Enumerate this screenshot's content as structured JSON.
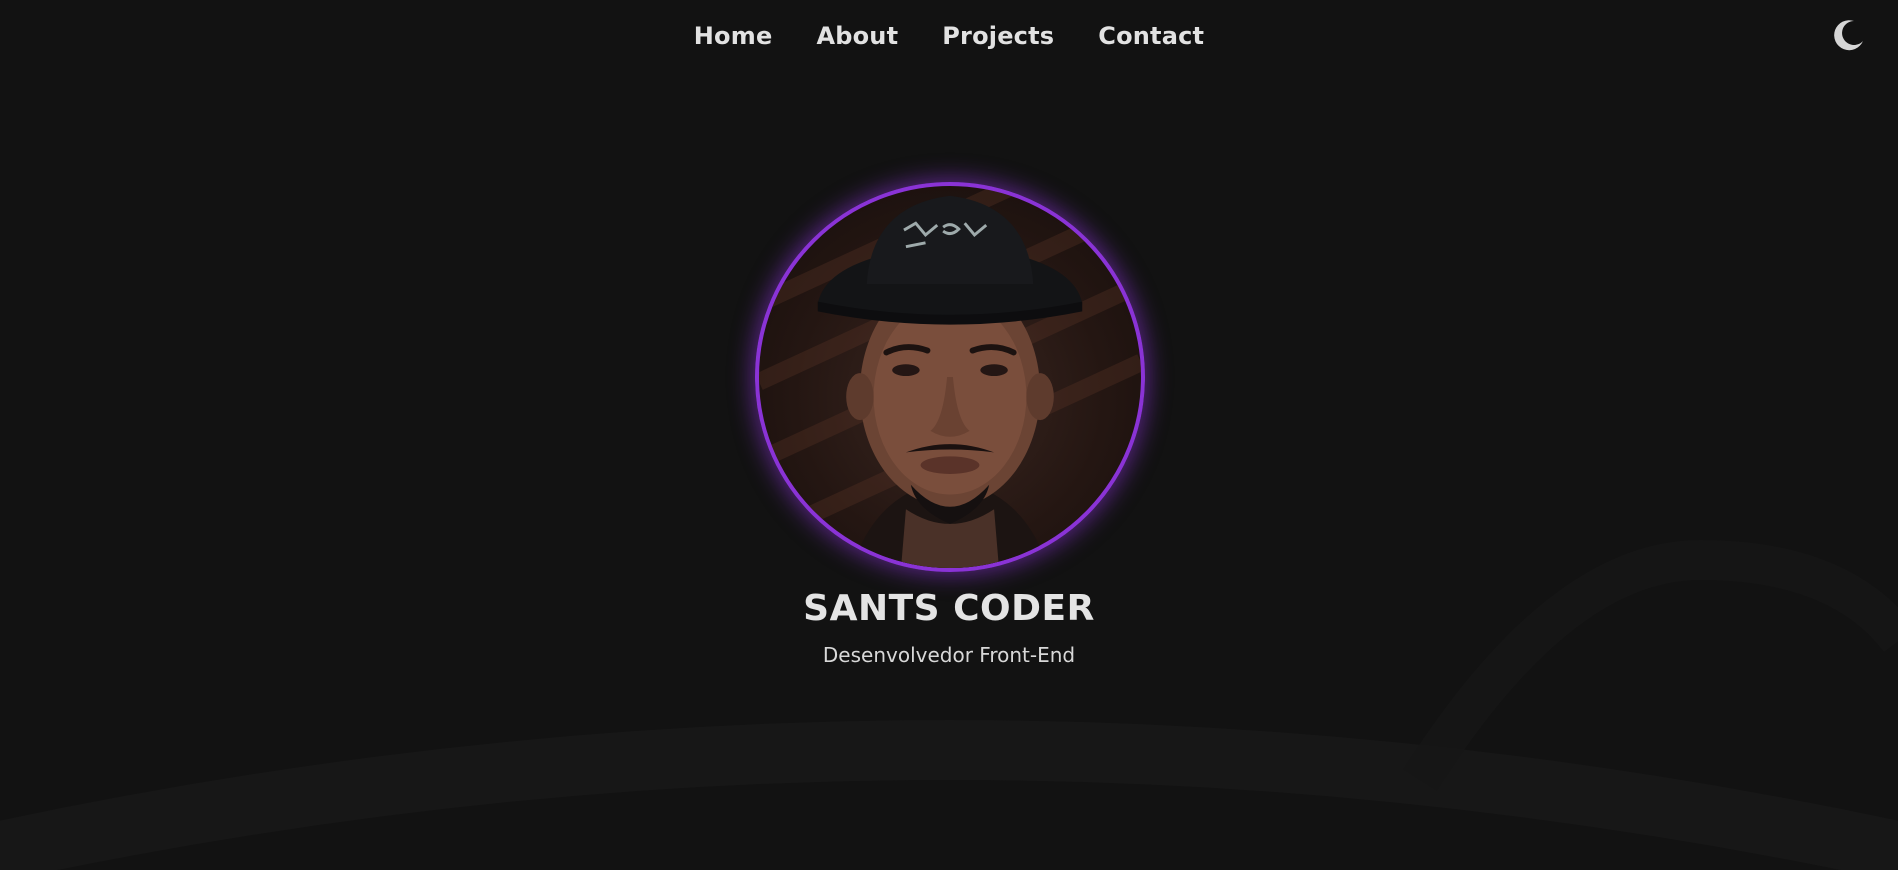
{
  "nav": {
    "items": [
      {
        "label": "Home"
      },
      {
        "label": "About"
      },
      {
        "label": "Projects"
      },
      {
        "label": "Contact"
      }
    ]
  },
  "theme_toggle": {
    "icon": "moon-icon"
  },
  "profile": {
    "name": "SANTS CODER",
    "role": "Desenvolvedor Front-End",
    "avatar_icon": "profile-photo"
  },
  "colors": {
    "background": "#121212",
    "accent": "#8a33d6",
    "text": "#e2e2e2"
  }
}
